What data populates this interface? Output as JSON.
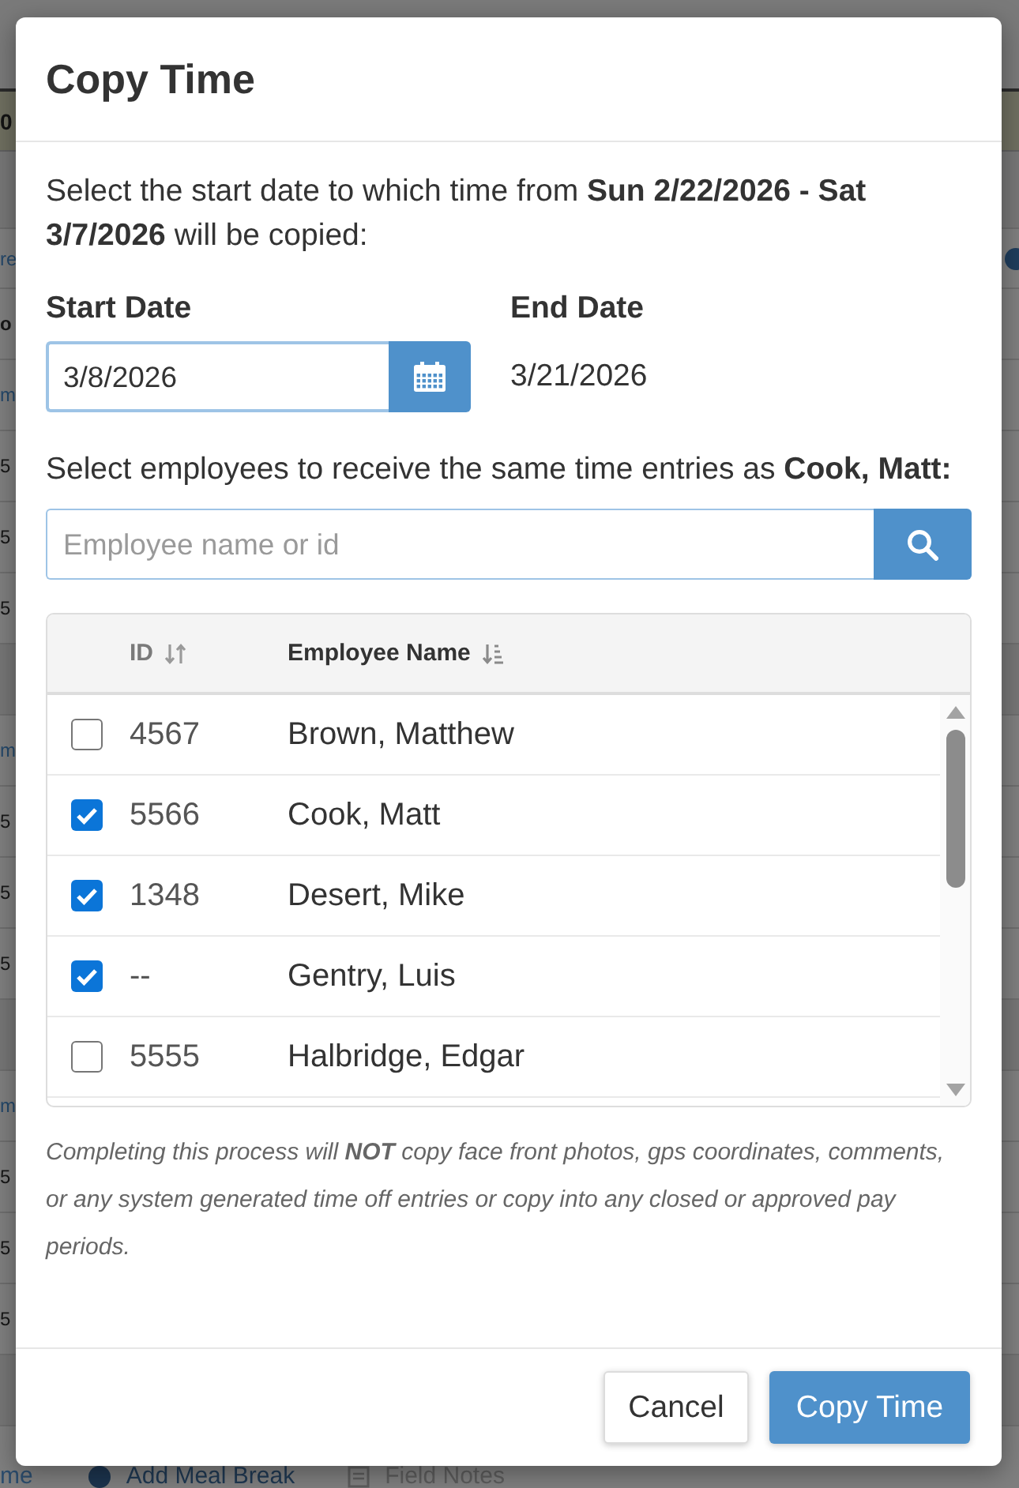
{
  "background": {
    "banner": "0",
    "header": {
      "link": "re",
      "label": "o"
    },
    "sections": [
      {
        "link": "m",
        "rows": [
          "5",
          "5",
          "5"
        ]
      },
      {
        "link": "m",
        "rows": [
          "5",
          "5",
          "5"
        ]
      },
      {
        "link": "m",
        "rows": [
          "5",
          "5",
          "5"
        ]
      }
    ],
    "bottom_bar": [
      {
        "kind": "link",
        "text": "me"
      },
      {
        "kind": "action",
        "text": "Add Meal Break"
      },
      {
        "kind": "notes",
        "text": "Field Notes"
      }
    ]
  },
  "dialog": {
    "title": "Copy Time",
    "instruction": "Select the start date to which time from **Sun 2/22/2026 - Sat 3/7/2026** will be copied:",
    "start_date": {
      "label": "Start Date",
      "value": "3/8/2026"
    },
    "end_date": {
      "label": "End Date",
      "value": "3/21/2026"
    },
    "employee_prompt": "Select employees to receive the same time entries as **Cook, Matt:**",
    "search": {
      "placeholder": "Employee name or id"
    },
    "table": {
      "columns": [
        {
          "label": "ID",
          "sorted": false
        },
        {
          "label": "Employee Name",
          "sorted": true
        }
      ],
      "rows": [
        {
          "id": "4567",
          "name": "Brown, Matthew",
          "checked": false
        },
        {
          "id": "5566",
          "name": "Cook, Matt",
          "checked": true
        },
        {
          "id": "1348",
          "name": "Desert, Mike",
          "checked": true
        },
        {
          "id": "--",
          "name": "Gentry, Luis",
          "checked": true
        },
        {
          "id": "5555",
          "name": "Halbridge, Edgar",
          "checked": false
        }
      ]
    },
    "note": "Completing this process will **NOT** copy face front photos, gps coordinates, comments, or any system generated time off entries or copy into any closed or approved pay periods.",
    "buttons": [
      {
        "label": "Cancel",
        "kind": "secondary"
      },
      {
        "label": "Copy Time",
        "kind": "primary"
      }
    ]
  }
}
